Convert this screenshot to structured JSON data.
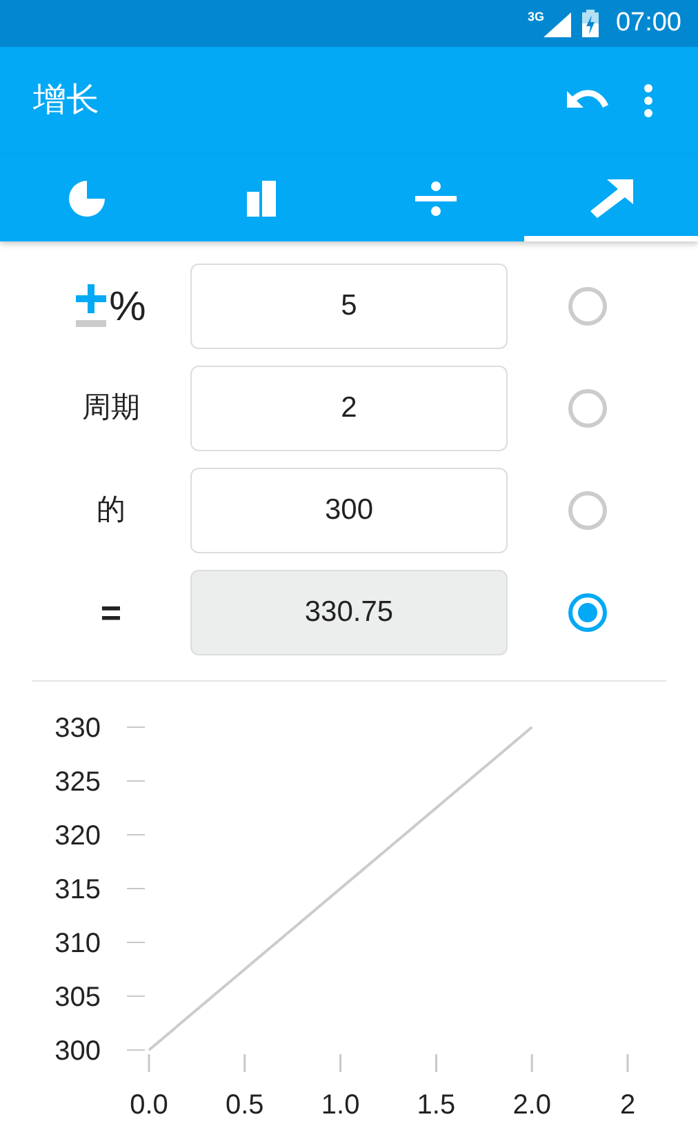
{
  "status_bar": {
    "network": "3G",
    "time": "07:00"
  },
  "app_bar": {
    "title": "增长"
  },
  "tabs": [
    {
      "kind": "pie",
      "selected": false
    },
    {
      "kind": "bars",
      "selected": false
    },
    {
      "kind": "divide",
      "selected": false
    },
    {
      "kind": "growth",
      "selected": true
    }
  ],
  "rows": [
    {
      "kind": "percent",
      "label": "%",
      "value": "5",
      "selected": false
    },
    {
      "kind": "text",
      "label": "周期",
      "value": "2",
      "selected": false
    },
    {
      "kind": "text",
      "label": "的",
      "value": "300",
      "selected": false
    },
    {
      "kind": "result",
      "label": "=",
      "value": "330.75",
      "selected": true
    }
  ],
  "chart": {
    "chart_data": {
      "type": "line",
      "x": [
        0,
        2
      ],
      "series": [
        {
          "color": "#cccccc",
          "values": [
            300,
            330
          ]
        }
      ],
      "xlim": [
        0,
        2.5
      ],
      "ylim": [
        300,
        330
      ],
      "xticks": [
        {
          "value": 0,
          "label": "0.0"
        },
        0.5,
        {
          "value": 1,
          "label": "1.0"
        },
        1.5,
        {
          "value": 2,
          "label": "2.0"
        },
        {
          "value": 2.5,
          "label": "2"
        }
      ],
      "yticks": [
        300,
        305,
        310,
        315,
        320,
        325,
        330
      ]
    }
  }
}
